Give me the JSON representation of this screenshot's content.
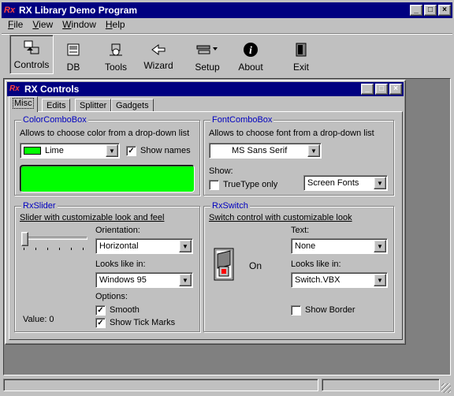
{
  "app": {
    "title": "RX Library Demo Program",
    "menu": [
      "File",
      "View",
      "Window",
      "Help"
    ],
    "toolbar": [
      {
        "label": "Controls",
        "icon": "controls-icon"
      },
      {
        "label": "DB",
        "icon": "database-icon"
      },
      {
        "label": "Tools",
        "icon": "tools-icon"
      },
      {
        "label": "Wizard",
        "icon": "wizard-icon"
      },
      {
        "label": "Setup",
        "icon": "setup-icon"
      },
      {
        "label": "About",
        "icon": "info-icon"
      },
      {
        "label": "Exit",
        "icon": "exit-icon"
      }
    ]
  },
  "child": {
    "title": "RX Controls",
    "tabs": [
      "Misc",
      "Edits",
      "Splitter",
      "Gadgets"
    ],
    "active_tab": "Misc"
  },
  "color_combo": {
    "title": "ColorComboBox",
    "description": "Allows to choose color from a drop-down list",
    "value": "Lime",
    "swatch_color": "#00ff00",
    "show_names_label": "Show names",
    "show_names_checked": true
  },
  "font_combo": {
    "title": "FontComboBox",
    "description": "Allows to choose font from a drop-down list",
    "value": "MS Sans Serif",
    "show_label": "Show:",
    "truetype_label": "TrueType only",
    "truetype_checked": false,
    "screen_fonts": "Screen Fonts"
  },
  "rx_slider": {
    "title": "RxSlider",
    "description": "Slider with customizable look and feel",
    "orientation_label": "Orientation:",
    "orientation_value": "Horizontal",
    "looks_label": "Looks like in:",
    "looks_value": "Windows 95",
    "options_label": "Options:",
    "smooth_label": "Smooth",
    "smooth_checked": true,
    "ticks_label": "Show Tick Marks",
    "ticks_checked": true,
    "value_text": "Value: 0"
  },
  "rx_switch": {
    "title": "RxSwitch",
    "description": "Switch control with customizable look",
    "state_text": "On",
    "text_label": "Text:",
    "text_value": "None",
    "looks_label": "Looks like in:",
    "looks_value": "Switch.VBX",
    "border_label": "Show Border",
    "border_checked": false
  },
  "colors": {
    "titlebar": "#000080",
    "lime": "#00ff00",
    "mdi_background": "#808080"
  }
}
